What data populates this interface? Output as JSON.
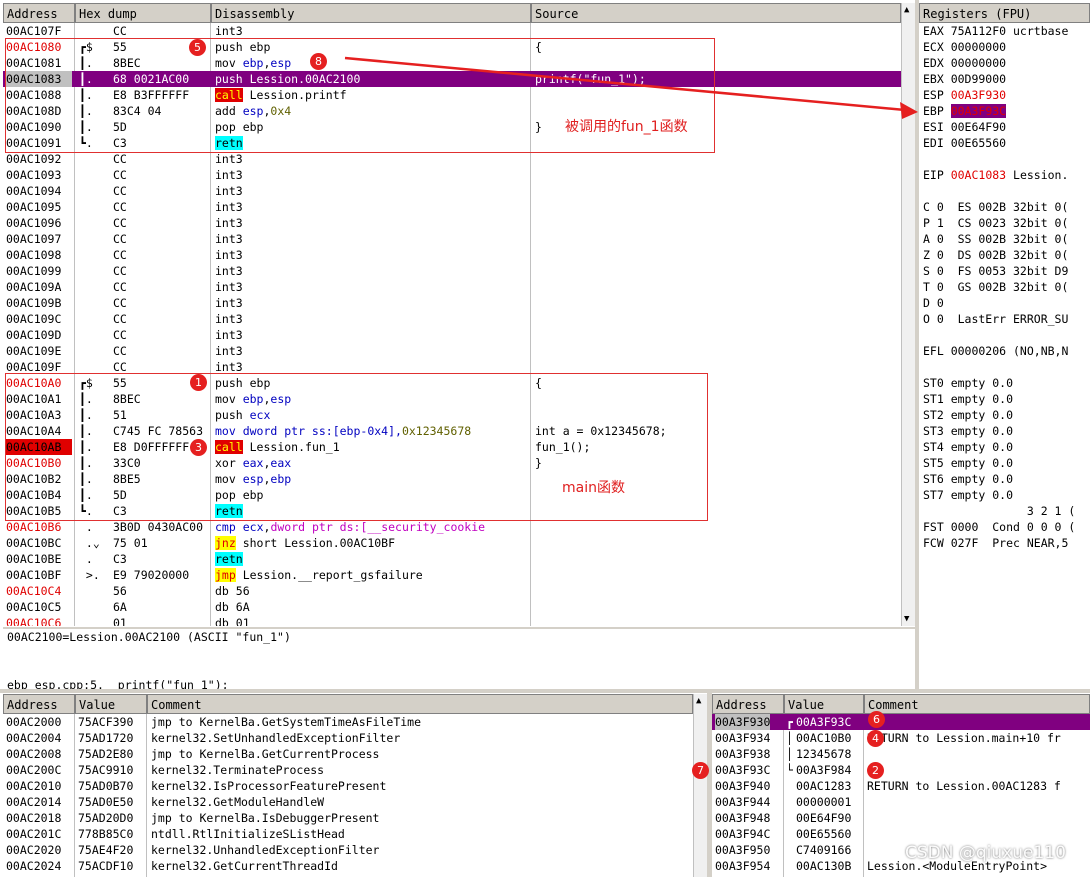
{
  "cpu": {
    "headers": [
      "Address",
      "Hex dump",
      "Disassembly",
      "Source"
    ],
    "rows": [
      {
        "addr": "00AC107F",
        "br": "",
        "hex": "CC",
        "asm": [
          {
            "t": "int3",
            "c": ""
          }
        ],
        "src": ""
      },
      {
        "addr": "00AC1080",
        "br": "┏$",
        "hex": "55",
        "asm": [
          {
            "t": "push ebp",
            "c": "kw-push"
          }
        ],
        "src": "{",
        "red": true
      },
      {
        "addr": "00AC1081",
        "br": "┃.",
        "hex": "8BEC",
        "asm": [
          {
            "t": "mov ",
            "c": ""
          },
          {
            "t": "ebp",
            "c": "kw-mov"
          },
          {
            "t": ",",
            "c": ""
          },
          {
            "t": "esp",
            "c": "kw-mov"
          }
        ],
        "src": ""
      },
      {
        "addr": "00AC1083",
        "br": "┃.",
        "hex": "68 0021AC00",
        "asm": [
          {
            "t": "push Lession.00AC2100",
            "c": ""
          }
        ],
        "src": "printf(\"fun_1\");",
        "sel": true
      },
      {
        "addr": "00AC1088",
        "br": "┃.",
        "hex": "E8 B3FFFFFF",
        "asm": [
          {
            "t": "call",
            "c": "kw-call"
          },
          {
            "t": " Lession.printf",
            "c": ""
          }
        ],
        "src": ""
      },
      {
        "addr": "00AC108D",
        "br": "┃.",
        "hex": "83C4 04",
        "asm": [
          {
            "t": "add ",
            "c": ""
          },
          {
            "t": "esp",
            "c": "kw-mov"
          },
          {
            "t": ",",
            "c": ""
          },
          {
            "t": "0x4",
            "c": "num"
          }
        ],
        "src": ""
      },
      {
        "addr": "00AC1090",
        "br": "┃.",
        "hex": "5D",
        "asm": [
          {
            "t": "pop ebp",
            "c": ""
          }
        ],
        "src": "}"
      },
      {
        "addr": "00AC1091",
        "br": "┗.",
        "hex": "C3",
        "asm": [
          {
            "t": "retn",
            "c": "kw-ret"
          }
        ],
        "src": ""
      },
      {
        "addr": "00AC1092",
        "br": "",
        "hex": "CC",
        "asm": [
          {
            "t": "int3",
            "c": ""
          }
        ],
        "src": ""
      },
      {
        "addr": "00AC1093",
        "br": "",
        "hex": "CC",
        "asm": [
          {
            "t": "int3",
            "c": ""
          }
        ],
        "src": ""
      },
      {
        "addr": "00AC1094",
        "br": "",
        "hex": "CC",
        "asm": [
          {
            "t": "int3",
            "c": ""
          }
        ],
        "src": ""
      },
      {
        "addr": "00AC1095",
        "br": "",
        "hex": "CC",
        "asm": [
          {
            "t": "int3",
            "c": ""
          }
        ],
        "src": ""
      },
      {
        "addr": "00AC1096",
        "br": "",
        "hex": "CC",
        "asm": [
          {
            "t": "int3",
            "c": ""
          }
        ],
        "src": ""
      },
      {
        "addr": "00AC1097",
        "br": "",
        "hex": "CC",
        "asm": [
          {
            "t": "int3",
            "c": ""
          }
        ],
        "src": ""
      },
      {
        "addr": "00AC1098",
        "br": "",
        "hex": "CC",
        "asm": [
          {
            "t": "int3",
            "c": ""
          }
        ],
        "src": ""
      },
      {
        "addr": "00AC1099",
        "br": "",
        "hex": "CC",
        "asm": [
          {
            "t": "int3",
            "c": ""
          }
        ],
        "src": ""
      },
      {
        "addr": "00AC109A",
        "br": "",
        "hex": "CC",
        "asm": [
          {
            "t": "int3",
            "c": ""
          }
        ],
        "src": ""
      },
      {
        "addr": "00AC109B",
        "br": "",
        "hex": "CC",
        "asm": [
          {
            "t": "int3",
            "c": ""
          }
        ],
        "src": ""
      },
      {
        "addr": "00AC109C",
        "br": "",
        "hex": "CC",
        "asm": [
          {
            "t": "int3",
            "c": ""
          }
        ],
        "src": ""
      },
      {
        "addr": "00AC109D",
        "br": "",
        "hex": "CC",
        "asm": [
          {
            "t": "int3",
            "c": ""
          }
        ],
        "src": ""
      },
      {
        "addr": "00AC109E",
        "br": "",
        "hex": "CC",
        "asm": [
          {
            "t": "int3",
            "c": ""
          }
        ],
        "src": ""
      },
      {
        "addr": "00AC109F",
        "br": "",
        "hex": "CC",
        "asm": [
          {
            "t": "int3",
            "c": ""
          }
        ],
        "src": ""
      },
      {
        "addr": "00AC10A0",
        "br": "┏$",
        "hex": "55",
        "asm": [
          {
            "t": "push ebp",
            "c": ""
          }
        ],
        "src": "{",
        "red": true
      },
      {
        "addr": "00AC10A1",
        "br": "┃.",
        "hex": "8BEC",
        "asm": [
          {
            "t": "mov ",
            "c": ""
          },
          {
            "t": "ebp",
            "c": "kw-mov"
          },
          {
            "t": ",",
            "c": ""
          },
          {
            "t": "esp",
            "c": "kw-mov"
          }
        ],
        "src": ""
      },
      {
        "addr": "00AC10A3",
        "br": "┃.",
        "hex": "51",
        "asm": [
          {
            "t": "push ",
            "c": ""
          },
          {
            "t": "ecx",
            "c": "kw-mov"
          }
        ],
        "src": ""
      },
      {
        "addr": "00AC10A4",
        "br": "┃.",
        "hex": "C745 FC 78563",
        "asm": [
          {
            "t": "mov dword ptr ss:[ebp-0x4],",
            "c": "kw-mov"
          },
          {
            "t": "0x12345678",
            "c": "num"
          }
        ],
        "src": "int a = 0x12345678;"
      },
      {
        "addr": "00AC10AB",
        "br": "┃.",
        "hex": "E8 D0FFFFFF",
        "asm": [
          {
            "t": "call",
            "c": "kw-call"
          },
          {
            "t": " Lession.fun_1",
            "c": ""
          }
        ],
        "src": "fun_1();",
        "redbg": true
      },
      {
        "addr": "00AC10B0",
        "br": "┃.",
        "hex": "33C0",
        "asm": [
          {
            "t": "xor ",
            "c": ""
          },
          {
            "t": "eax",
            "c": "kw-mov"
          },
          {
            "t": ",",
            "c": ""
          },
          {
            "t": "eax",
            "c": "kw-mov"
          }
        ],
        "src": "}",
        "red": true
      },
      {
        "addr": "00AC10B2",
        "br": "┃.",
        "hex": "8BE5",
        "asm": [
          {
            "t": "mov ",
            "c": ""
          },
          {
            "t": "esp",
            "c": "kw-mov"
          },
          {
            "t": ",",
            "c": ""
          },
          {
            "t": "ebp",
            "c": "kw-mov"
          }
        ],
        "src": ""
      },
      {
        "addr": "00AC10B4",
        "br": "┃.",
        "hex": "5D",
        "asm": [
          {
            "t": "pop ebp",
            "c": ""
          }
        ],
        "src": ""
      },
      {
        "addr": "00AC10B5",
        "br": "┗.",
        "hex": "C3",
        "asm": [
          {
            "t": "retn",
            "c": "kw-ret"
          }
        ],
        "src": ""
      },
      {
        "addr": "00AC10B6",
        "br": " .",
        "hex": "3B0D 0430AC00",
        "asm": [
          {
            "t": "cmp",
            "c": "kw-mov"
          },
          {
            "t": " ",
            "c": ""
          },
          {
            "t": "ecx",
            "c": "kw-mov"
          },
          {
            "t": ",",
            "c": ""
          },
          {
            "t": "dword ptr ds:[__security_cookie",
            "c": "sym"
          }
        ],
        "src": "",
        "red": true
      },
      {
        "addr": "00AC10BC",
        "br": " .⌄",
        "hex": "75 01",
        "asm": [
          {
            "t": "jnz",
            "c": "kw-jmp"
          },
          {
            "t": " short Lession.00AC10BF",
            "c": ""
          }
        ],
        "src": ""
      },
      {
        "addr": "00AC10BE",
        "br": " .",
        "hex": "C3",
        "asm": [
          {
            "t": "retn",
            "c": "kw-ret"
          }
        ],
        "src": ""
      },
      {
        "addr": "00AC10BF",
        "br": " >.",
        "hex": "E9 79020000",
        "asm": [
          {
            "t": "jmp",
            "c": "kw-jmp"
          },
          {
            "t": " Lession.__report_gsfailure",
            "c": ""
          }
        ],
        "src": ""
      },
      {
        "addr": "00AC10C4",
        "br": "",
        "hex": "56",
        "asm": [
          {
            "t": "db 56",
            "c": ""
          }
        ],
        "src": "",
        "red": true
      },
      {
        "addr": "00AC10C5",
        "br": "",
        "hex": "6A",
        "asm": [
          {
            "t": "db 6A",
            "c": ""
          }
        ],
        "src": ""
      },
      {
        "addr": "00AC10C6",
        "br": "",
        "hex": "01",
        "asm": [
          {
            "t": "db 01",
            "c": ""
          }
        ],
        "src": "",
        "red": true
      }
    ],
    "info_line1": "00AC2100=Lession.00AC2100 (ASCII \"fun_1\")",
    "info_line2": "ebp_esp.cpp:5.  printf(\"fun_1\");"
  },
  "registers": {
    "title": "Registers (FPU)",
    "lines": [
      {
        "t": "EAX 75A112F0 ucrtbase",
        "c": ""
      },
      {
        "t": "ECX 00000000",
        "c": ""
      },
      {
        "t": "EDX 00000000",
        "c": ""
      },
      {
        "t": "EBX 00D99000",
        "c": ""
      },
      {
        "t": "ESP ",
        "c": "",
        "v": "00A3F930",
        "vc": "red"
      },
      {
        "t": "EBP ",
        "c": "",
        "v": "00A3F93C",
        "vc": "hilite"
      },
      {
        "t": "ESI 00E64F90",
        "c": ""
      },
      {
        "t": "EDI 00E65560",
        "c": ""
      },
      {
        "t": "",
        "c": ""
      },
      {
        "t": "EIP ",
        "c": "",
        "v": "00AC1083",
        "vc": "red",
        "rest": " Lession."
      },
      {
        "t": "",
        "c": ""
      },
      {
        "t": "C 0  ES 002B 32bit 0(",
        "c": ""
      },
      {
        "t": "P 1  CS 0023 32bit 0(",
        "c": ""
      },
      {
        "t": "A 0  SS 002B 32bit 0(",
        "c": ""
      },
      {
        "t": "Z 0  DS 002B 32bit 0(",
        "c": ""
      },
      {
        "t": "S 0  FS 0053 32bit D9",
        "c": ""
      },
      {
        "t": "T 0  GS 002B 32bit 0(",
        "c": ""
      },
      {
        "t": "D 0",
        "c": ""
      },
      {
        "t": "O 0  LastErr ERROR_SU",
        "c": ""
      },
      {
        "t": "",
        "c": ""
      },
      {
        "t": "EFL 00000206 (NO,NB,N",
        "c": ""
      },
      {
        "t": "",
        "c": ""
      },
      {
        "t": "ST0 empty 0.0",
        "c": ""
      },
      {
        "t": "ST1 empty 0.0",
        "c": ""
      },
      {
        "t": "ST2 empty 0.0",
        "c": ""
      },
      {
        "t": "ST3 empty 0.0",
        "c": ""
      },
      {
        "t": "ST4 empty 0.0",
        "c": ""
      },
      {
        "t": "ST5 empty 0.0",
        "c": ""
      },
      {
        "t": "ST6 empty 0.0",
        "c": ""
      },
      {
        "t": "ST7 empty 0.0",
        "c": ""
      },
      {
        "t": "               3 2 1 (",
        "c": ""
      },
      {
        "t": "FST 0000  Cond 0 0 0 (",
        "c": ""
      },
      {
        "t": "FCW 027F  Prec NEAR,5",
        "c": ""
      }
    ]
  },
  "dump": {
    "headers": [
      "Address",
      "Value",
      "Comment"
    ],
    "rows": [
      [
        "00AC2000",
        "75ACF390",
        "jmp to KernelBa.GetSystemTimeAsFileTime"
      ],
      [
        "00AC2004",
        "75AD1720",
        "kernel32.SetUnhandledExceptionFilter"
      ],
      [
        "00AC2008",
        "75AD2E80",
        "jmp to KernelBa.GetCurrentProcess"
      ],
      [
        "00AC200C",
        "75AC9910",
        "kernel32.TerminateProcess"
      ],
      [
        "00AC2010",
        "75AD0B70",
        "kernel32.IsProcessorFeaturePresent"
      ],
      [
        "00AC2014",
        "75AD0E50",
        "kernel32.GetModuleHandleW"
      ],
      [
        "00AC2018",
        "75AD20D0",
        "jmp to KernelBa.IsDebuggerPresent"
      ],
      [
        "00AC201C",
        "778B85C0",
        "ntdll.RtlInitializeSListHead"
      ],
      [
        "00AC2020",
        "75AE4F20",
        "kernel32.UnhandledExceptionFilter"
      ],
      [
        "00AC2024",
        "75ACDF10",
        "kernel32.GetCurrentThreadId"
      ]
    ]
  },
  "stack": {
    "headers": [
      "Address",
      "Value",
      "Comment"
    ],
    "rows": [
      {
        "addr": "00A3F930",
        "br": "┏",
        "val": "00A3F93C",
        "cmt": "",
        "sel": true
      },
      {
        "addr": "00A3F934",
        "br": "│",
        "val": "00AC10B0",
        "cmt": "RETURN to Lession.main+10 fr"
      },
      {
        "addr": "00A3F938",
        "br": "│",
        "val": "12345678",
        "cmt": ""
      },
      {
        "addr": "00A3F93C",
        "br": "└",
        "val": "00A3F984",
        "cmt": ""
      },
      {
        "addr": "00A3F940",
        "br": " ",
        "val": "00AC1283",
        "cmt": "RETURN to Lession.00AC1283 f"
      },
      {
        "addr": "00A3F944",
        "br": " ",
        "val": "00000001",
        "cmt": ""
      },
      {
        "addr": "00A3F948",
        "br": " ",
        "val": "00E64F90",
        "cmt": ""
      },
      {
        "addr": "00A3F94C",
        "br": " ",
        "val": "00E65560",
        "cmt": ""
      },
      {
        "addr": "00A3F950",
        "br": " ",
        "val": "C7409166",
        "cmt": ""
      },
      {
        "addr": "00A3F954",
        "br": " ",
        "val": "00AC130B",
        "cmt": "Lession.<ModuleEntryPoint>"
      }
    ]
  },
  "annotations": {
    "fun1_label": "被调用的fun_1函数",
    "main_label": "main函数",
    "badges": [
      "5",
      "8",
      "1",
      "3",
      "6",
      "4",
      "2",
      "7"
    ],
    "watermark": "CSDN @qiuxue110",
    "accent": "#e52020"
  }
}
